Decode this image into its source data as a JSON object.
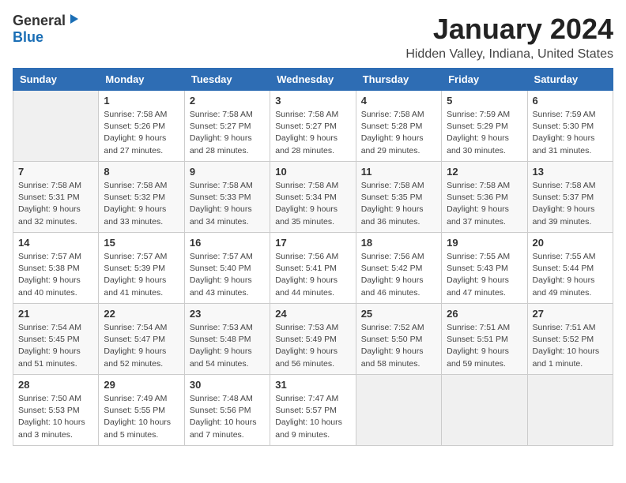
{
  "app": {
    "logo_general": "General",
    "logo_blue": "Blue"
  },
  "calendar": {
    "title": "January 2024",
    "subtitle": "Hidden Valley, Indiana, United States",
    "headers": [
      "Sunday",
      "Monday",
      "Tuesday",
      "Wednesday",
      "Thursday",
      "Friday",
      "Saturday"
    ],
    "weeks": [
      [
        {
          "day": "",
          "info": ""
        },
        {
          "day": "1",
          "info": "Sunrise: 7:58 AM\nSunset: 5:26 PM\nDaylight: 9 hours\nand 27 minutes."
        },
        {
          "day": "2",
          "info": "Sunrise: 7:58 AM\nSunset: 5:27 PM\nDaylight: 9 hours\nand 28 minutes."
        },
        {
          "day": "3",
          "info": "Sunrise: 7:58 AM\nSunset: 5:27 PM\nDaylight: 9 hours\nand 28 minutes."
        },
        {
          "day": "4",
          "info": "Sunrise: 7:58 AM\nSunset: 5:28 PM\nDaylight: 9 hours\nand 29 minutes."
        },
        {
          "day": "5",
          "info": "Sunrise: 7:59 AM\nSunset: 5:29 PM\nDaylight: 9 hours\nand 30 minutes."
        },
        {
          "day": "6",
          "info": "Sunrise: 7:59 AM\nSunset: 5:30 PM\nDaylight: 9 hours\nand 31 minutes."
        }
      ],
      [
        {
          "day": "7",
          "info": "Sunrise: 7:58 AM\nSunset: 5:31 PM\nDaylight: 9 hours\nand 32 minutes."
        },
        {
          "day": "8",
          "info": "Sunrise: 7:58 AM\nSunset: 5:32 PM\nDaylight: 9 hours\nand 33 minutes."
        },
        {
          "day": "9",
          "info": "Sunrise: 7:58 AM\nSunset: 5:33 PM\nDaylight: 9 hours\nand 34 minutes."
        },
        {
          "day": "10",
          "info": "Sunrise: 7:58 AM\nSunset: 5:34 PM\nDaylight: 9 hours\nand 35 minutes."
        },
        {
          "day": "11",
          "info": "Sunrise: 7:58 AM\nSunset: 5:35 PM\nDaylight: 9 hours\nand 36 minutes."
        },
        {
          "day": "12",
          "info": "Sunrise: 7:58 AM\nSunset: 5:36 PM\nDaylight: 9 hours\nand 37 minutes."
        },
        {
          "day": "13",
          "info": "Sunrise: 7:58 AM\nSunset: 5:37 PM\nDaylight: 9 hours\nand 39 minutes."
        }
      ],
      [
        {
          "day": "14",
          "info": "Sunrise: 7:57 AM\nSunset: 5:38 PM\nDaylight: 9 hours\nand 40 minutes."
        },
        {
          "day": "15",
          "info": "Sunrise: 7:57 AM\nSunset: 5:39 PM\nDaylight: 9 hours\nand 41 minutes."
        },
        {
          "day": "16",
          "info": "Sunrise: 7:57 AM\nSunset: 5:40 PM\nDaylight: 9 hours\nand 43 minutes."
        },
        {
          "day": "17",
          "info": "Sunrise: 7:56 AM\nSunset: 5:41 PM\nDaylight: 9 hours\nand 44 minutes."
        },
        {
          "day": "18",
          "info": "Sunrise: 7:56 AM\nSunset: 5:42 PM\nDaylight: 9 hours\nand 46 minutes."
        },
        {
          "day": "19",
          "info": "Sunrise: 7:55 AM\nSunset: 5:43 PM\nDaylight: 9 hours\nand 47 minutes."
        },
        {
          "day": "20",
          "info": "Sunrise: 7:55 AM\nSunset: 5:44 PM\nDaylight: 9 hours\nand 49 minutes."
        }
      ],
      [
        {
          "day": "21",
          "info": "Sunrise: 7:54 AM\nSunset: 5:45 PM\nDaylight: 9 hours\nand 51 minutes."
        },
        {
          "day": "22",
          "info": "Sunrise: 7:54 AM\nSunset: 5:47 PM\nDaylight: 9 hours\nand 52 minutes."
        },
        {
          "day": "23",
          "info": "Sunrise: 7:53 AM\nSunset: 5:48 PM\nDaylight: 9 hours\nand 54 minutes."
        },
        {
          "day": "24",
          "info": "Sunrise: 7:53 AM\nSunset: 5:49 PM\nDaylight: 9 hours\nand 56 minutes."
        },
        {
          "day": "25",
          "info": "Sunrise: 7:52 AM\nSunset: 5:50 PM\nDaylight: 9 hours\nand 58 minutes."
        },
        {
          "day": "26",
          "info": "Sunrise: 7:51 AM\nSunset: 5:51 PM\nDaylight: 9 hours\nand 59 minutes."
        },
        {
          "day": "27",
          "info": "Sunrise: 7:51 AM\nSunset: 5:52 PM\nDaylight: 10 hours\nand 1 minute."
        }
      ],
      [
        {
          "day": "28",
          "info": "Sunrise: 7:50 AM\nSunset: 5:53 PM\nDaylight: 10 hours\nand 3 minutes."
        },
        {
          "day": "29",
          "info": "Sunrise: 7:49 AM\nSunset: 5:55 PM\nDaylight: 10 hours\nand 5 minutes."
        },
        {
          "day": "30",
          "info": "Sunrise: 7:48 AM\nSunset: 5:56 PM\nDaylight: 10 hours\nand 7 minutes."
        },
        {
          "day": "31",
          "info": "Sunrise: 7:47 AM\nSunset: 5:57 PM\nDaylight: 10 hours\nand 9 minutes."
        },
        {
          "day": "",
          "info": ""
        },
        {
          "day": "",
          "info": ""
        },
        {
          "day": "",
          "info": ""
        }
      ]
    ]
  }
}
